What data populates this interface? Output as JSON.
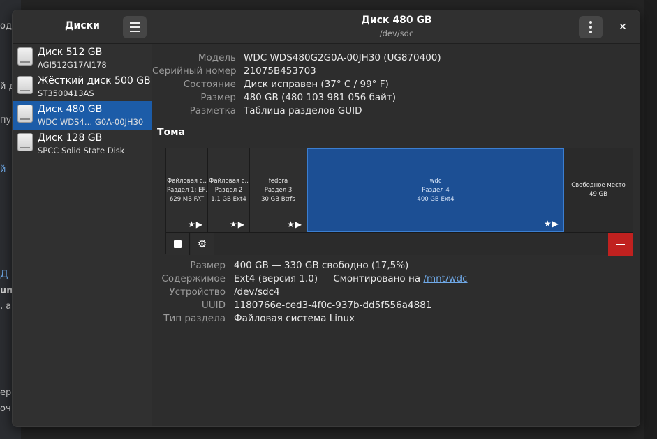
{
  "background": {
    "fragments": [
      "од",
      "",
      "й д",
      "пу",
      "",
      "й",
      "",
      "Д",
      "unt",
      ", а",
      "",
      "",
      "ер",
      "оч"
    ]
  },
  "sidebar": {
    "title": "Диски",
    "menu_icon": "hamburger-icon",
    "disks": [
      {
        "name": "Диск 512 GB",
        "sub": "AGI512G17AI178",
        "selected": false
      },
      {
        "name": "Жёсткий диск 500 GB",
        "sub": "ST3500413AS",
        "selected": false
      },
      {
        "name": "Диск 480 GB",
        "sub": "WDC WDS4…  G0A-00JH30",
        "selected": true
      },
      {
        "name": "Диск 128 GB",
        "sub": "SPCC Solid State Disk",
        "selected": false
      }
    ]
  },
  "header": {
    "title": "Диск 480 GB",
    "subtitle": "/dev/sdc",
    "close_label": "✕"
  },
  "drive": {
    "model_label": "Модель",
    "model": "WDC WDS480G2G0A-00JH30 (UG870400)",
    "serial_label": "Серийный номер",
    "serial": "21075B453703",
    "state_label": "Состояние",
    "state": "Диск исправен (37° C / 99° F)",
    "size_label": "Размер",
    "size": "480 GB (480 103 981 056 байт)",
    "layout_label": "Разметка",
    "layout": "Таблица разделов GUID"
  },
  "volumes": {
    "title": "Тома",
    "items": [
      {
        "l1": "Файловая с…",
        "l2": "Раздел 1: EF…",
        "l3": "629 MB FAT",
        "icons": "★▶",
        "selected": false
      },
      {
        "l1": "Файловая с…",
        "l2": "Раздел 2",
        "l3": "1,1 GB Ext4",
        "icons": "★▶",
        "selected": false
      },
      {
        "l1": "fedora",
        "l2": "Раздел 3",
        "l3": "30 GB Btrfs",
        "icons": "★▶",
        "selected": false
      },
      {
        "l1": "wdc",
        "l2": "Раздел 4",
        "l3": "400 GB Ext4",
        "icons": "★▶",
        "selected": true
      },
      {
        "l1": "Свободное место",
        "l2": "49 GB",
        "l3": "",
        "icons": "",
        "selected": false
      }
    ],
    "toolbar": {
      "stop_icon": "stop-icon",
      "settings_icon": "gear-icon",
      "delete_icon": "minus-icon"
    }
  },
  "partition": {
    "size_label": "Размер",
    "size": "400 GB — 330 GB свободно (17,5%)",
    "contents_label": "Содержимое",
    "contents_prefix": "Ext4 (версия 1.0) — Смонтировано на",
    "mount_link": "/mnt/wdc",
    "device_label": "Устройство",
    "device": "/dev/sdc4",
    "uuid_label": "UUID",
    "uuid": "1180766e-ced3-4f0c-937b-dd5f556a4881",
    "type_label": "Тип раздела",
    "type": "Файловая система Linux"
  },
  "colors": {
    "accent": "#1c5ca8",
    "selected_volume": "#1c4f94",
    "destructive": "#c0211f",
    "link": "#6fa8e6"
  }
}
